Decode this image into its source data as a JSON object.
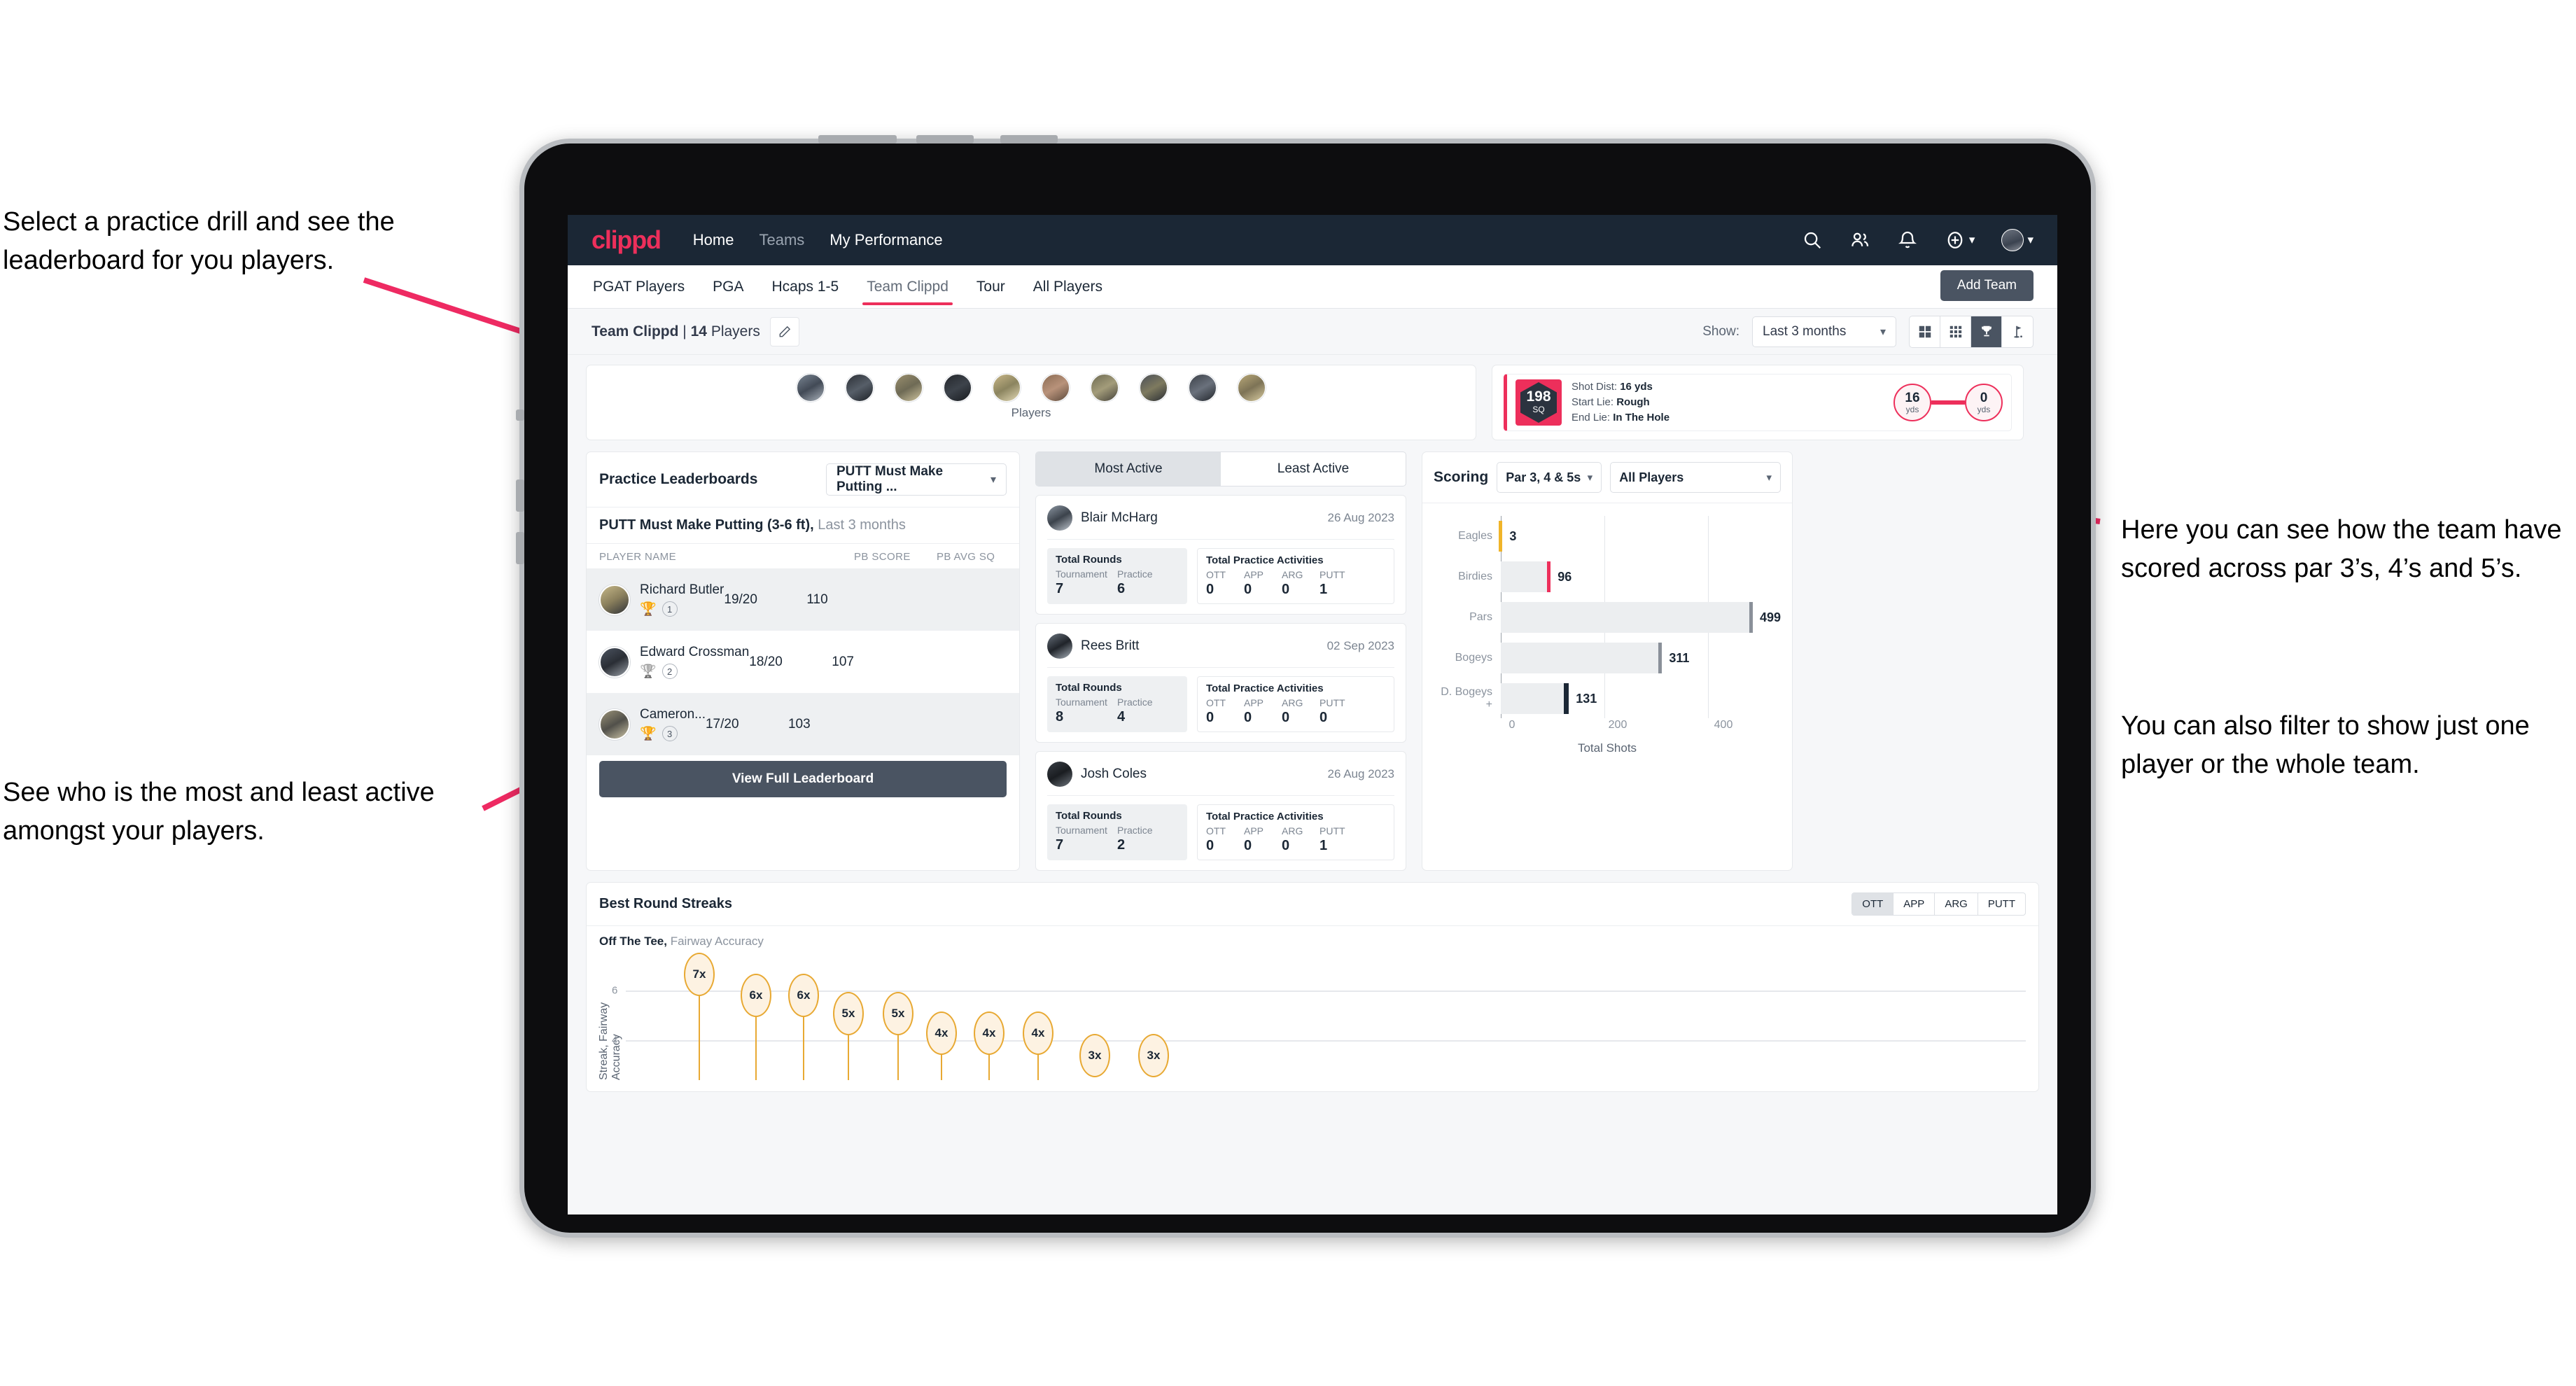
{
  "annotations": {
    "top_left": "Select a practice drill and see the leaderboard for you players.",
    "bottom_left": "See who is the most and least active amongst your players.",
    "right_1": "Here you can see how the team have scored across par 3’s, 4’s and 5’s.",
    "right_2": "You can also filter to show just one player or the whole team."
  },
  "topbar": {
    "logo": "clippd",
    "links": [
      "Home",
      "Teams",
      "My Performance"
    ],
    "icons": [
      "search-icon",
      "people-icon",
      "bell-icon",
      "plus-circle-icon",
      "avatar"
    ]
  },
  "tabs": {
    "items": [
      "PGAT Players",
      "PGA",
      "Hcaps 1-5",
      "Team Clippd",
      "Tour",
      "All Players"
    ],
    "active": "Team Clippd",
    "add_team_label": "Add Team"
  },
  "subheader": {
    "team_name": "Team Clippd",
    "separator": "|",
    "player_count": "14",
    "players_word": "Players",
    "show_label": "Show:",
    "range_value": "Last 3 months",
    "view_toggles": [
      "grid-large-icon",
      "grid-small-icon",
      "trophy-icon",
      "flag-icon"
    ],
    "active_view": "trophy-icon"
  },
  "players_strip": {
    "label": "Players",
    "count": 10
  },
  "shot_card": {
    "sq_value": "198",
    "sq_unit": "SQ",
    "lines": [
      {
        "label": "Shot Dist:",
        "value": "16 yds"
      },
      {
        "label": "Start Lie:",
        "value": "Rough"
      },
      {
        "label": "End Lie:",
        "value": "In The Hole"
      }
    ],
    "start_dist": "16",
    "start_unit": "yds",
    "end_dist": "0",
    "end_unit": "yds"
  },
  "leaderboard": {
    "title": "Practice Leaderboards",
    "drill_select": "PUTT Must Make Putting ...",
    "subtitle_bold": "PUTT Must Make Putting (3-6 ft),",
    "subtitle_rest": " Last 3 months",
    "columns": [
      "PLAYER NAME",
      "PB SCORE",
      "PB AVG SQ"
    ],
    "rows": [
      {
        "name": "Richard Butler",
        "rank": "1",
        "trophy": "gold",
        "score": "19/20",
        "avg": "110"
      },
      {
        "name": "Edward Crossman",
        "rank": "2",
        "trophy": "silver",
        "score": "18/20",
        "avg": "107"
      },
      {
        "name": "Cameron...",
        "rank": "3",
        "trophy": "bronze",
        "score": "17/20",
        "avg": "103"
      }
    ],
    "view_full_label": "View Full Leaderboard"
  },
  "activity": {
    "tabs": [
      "Most Active",
      "Least Active"
    ],
    "active_tab": "Most Active",
    "rounds_title": "Total Rounds",
    "rounds_cols": [
      "Tournament",
      "Practice"
    ],
    "acts_title": "Total Practice Activities",
    "acts_cols": [
      "OTT",
      "APP",
      "ARG",
      "PUTT"
    ],
    "items": [
      {
        "name": "Blair McHarg",
        "date": "26 Aug 2023",
        "rounds": [
          "7",
          "6"
        ],
        "acts": [
          "0",
          "0",
          "0",
          "1"
        ]
      },
      {
        "name": "Rees Britt",
        "date": "02 Sep 2023",
        "rounds": [
          "8",
          "4"
        ],
        "acts": [
          "0",
          "0",
          "0",
          "0"
        ]
      },
      {
        "name": "Josh Coles",
        "date": "26 Aug 2023",
        "rounds": [
          "7",
          "2"
        ],
        "acts": [
          "0",
          "0",
          "0",
          "1"
        ]
      }
    ]
  },
  "scoring": {
    "title": "Scoring",
    "par_filter": "Par 3, 4 & 5s",
    "player_filter": "All Players"
  },
  "streaks": {
    "title": "Best Round Streaks",
    "toggles": [
      "OTT",
      "APP",
      "ARG",
      "PUTT"
    ],
    "active_toggle": "OTT",
    "sub_bold": "Off The Tee,",
    "sub_rest": " Fairway Accuracy"
  },
  "chart_data": [
    {
      "type": "bar",
      "orientation": "horizontal",
      "title": "Scoring",
      "categories": [
        "Eagles",
        "Birdies",
        "Pars",
        "Bogeys",
        "D. Bogeys +"
      ],
      "values": [
        3,
        96,
        499,
        311,
        131
      ],
      "cap_colors": [
        "#f0b429",
        "#ed2f5b",
        "#8a9099",
        "#8a9099",
        "#1b2735"
      ],
      "xlabel": "Total Shots",
      "ylabel": "",
      "xticks": [
        0,
        200,
        400
      ],
      "xlim": [
        0,
        540
      ],
      "grid": true,
      "legend": "none"
    },
    {
      "type": "scatter",
      "title": "Best Round Streaks",
      "subtitle": "Off The Tee, Fairway Accuracy",
      "ylabel": "Streak, Fairway Accuracy",
      "xlabel": "",
      "yticks": [
        4,
        6
      ],
      "ylim": [
        0,
        7.6
      ],
      "grid": true,
      "legend": "none",
      "labels": [
        "7x",
        "6x",
        "6x",
        "5x",
        "5x",
        "4x",
        "4x",
        "4x",
        "3x",
        "3x"
      ],
      "values": [
        7,
        6,
        6,
        5,
        5,
        4,
        4,
        4,
        3,
        3
      ]
    }
  ]
}
